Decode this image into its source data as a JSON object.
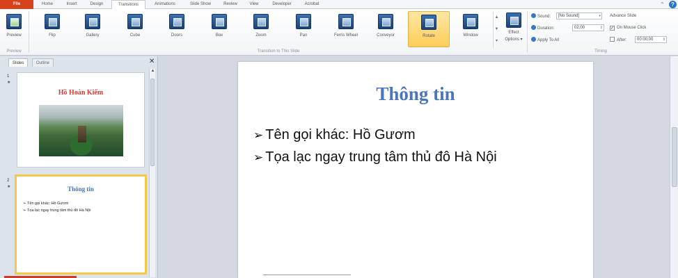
{
  "tabs": [
    "File",
    "Home",
    "Insert",
    "Design",
    "Transitions",
    "Animations",
    "Slide Show",
    "Review",
    "View",
    "Developer",
    "Acrobat"
  ],
  "active_tab": "Transitions",
  "ribbon": {
    "preview_label": "Preview",
    "preview_group": "Preview",
    "transitions": [
      "Flip",
      "Gallery",
      "Cube",
      "Doors",
      "Box",
      "Zoom",
      "Pan",
      "Ferris Wheel",
      "Conveyor",
      "Rotate",
      "Window"
    ],
    "selected_transition": "Rotate",
    "effect_options_line1": "Effect",
    "effect_options_line2": "Options ▾",
    "transition_group": "Transition to This Slide",
    "sound_label": "Sound:",
    "sound_value": "[No Sound]",
    "duration_label": "Duration:",
    "duration_value": "02,00",
    "apply_all_label": "Apply To All",
    "advance_label": "Advance Slide",
    "on_mouse_click_label": "On Mouse Click",
    "after_label": "After:",
    "after_value": "00:00,00",
    "timing_group": "Timing"
  },
  "panel": {
    "tab_slides": "Slides",
    "tab_outline": "Outline",
    "close_glyph": "✕",
    "slides": [
      {
        "num": "1",
        "star": "★",
        "title": "Hồ Hoàn Kiếm"
      },
      {
        "num": "2",
        "star": "★",
        "title": "Thông tin",
        "lines": [
          "➢ Tên gọi khác: Hồ Gươm",
          "➢ Tọa lạc ngay trung tâm thủ đô Hà Nội"
        ]
      }
    ]
  },
  "slide": {
    "title": "Thông tin",
    "bullet_mark": "➢",
    "bullets": [
      "Tên gọi khác: Hồ Gươm",
      "Tọa lạc ngay trung tâm thủ đô Hà Nội"
    ]
  },
  "colors": {
    "file_tab": "#d7421a",
    "selected": "#ffcd5a",
    "slide_title": "#4a76bb",
    "thumb_title_red": "#d63b3b"
  }
}
